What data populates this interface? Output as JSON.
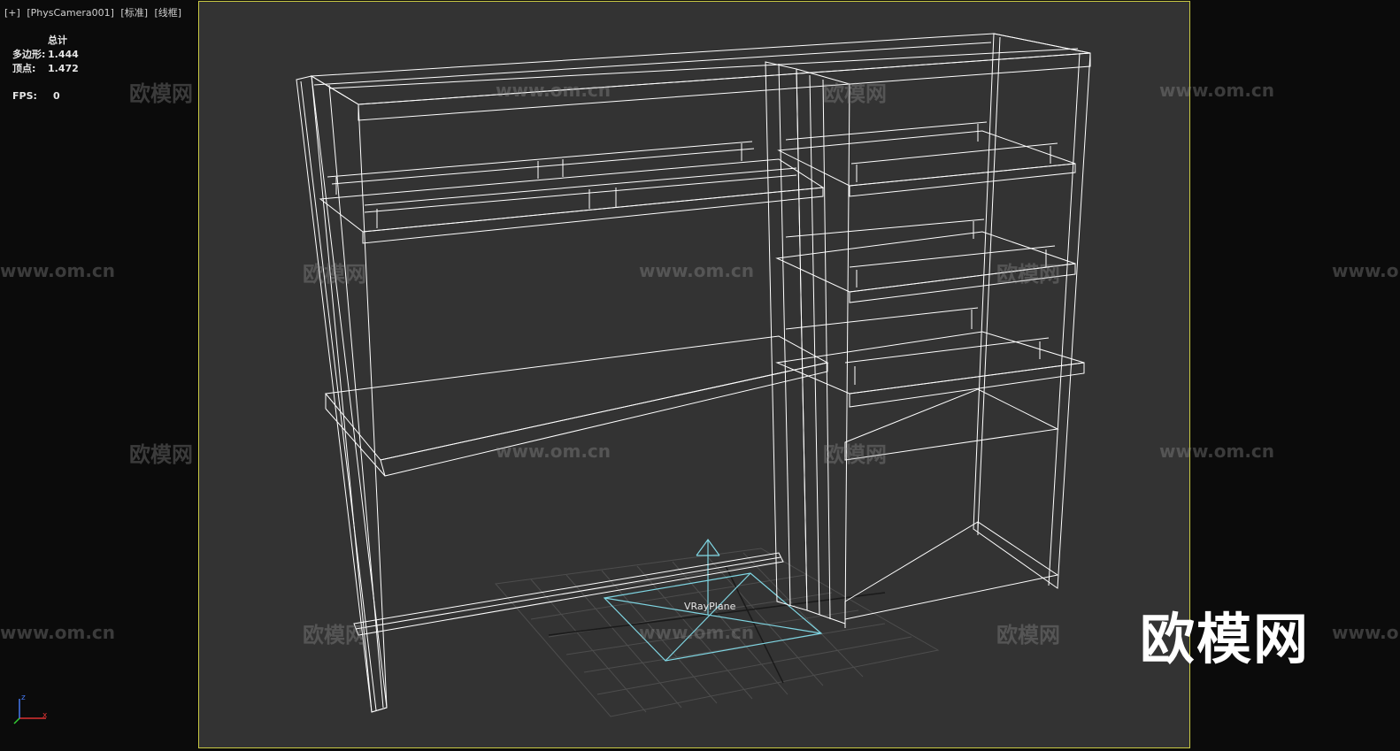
{
  "viewport": {
    "plus_label": "[+]",
    "camera_label": "[PhysCamera001]",
    "shading_label": "[标准]",
    "mode_label": "[线框]"
  },
  "stats": {
    "total_label": "总计",
    "polygons_label": "多边形:",
    "polygons_value": "1.444",
    "vertices_label": "顶点:",
    "vertices_value": "1.472",
    "fps_label": "FPS:",
    "fps_value": "0"
  },
  "scene": {
    "object_label": "VRayPlane",
    "wireframe_color": "#ffffff",
    "vrayplane_color": "#7fd6e3",
    "frame_color": "#c9c943"
  },
  "axis_gizmo": {
    "z_label": "z",
    "x_label": "x"
  },
  "watermarks": {
    "brand_text": "欧模网",
    "url_text": "www.om.cn",
    "logo_text": "欧模网"
  }
}
